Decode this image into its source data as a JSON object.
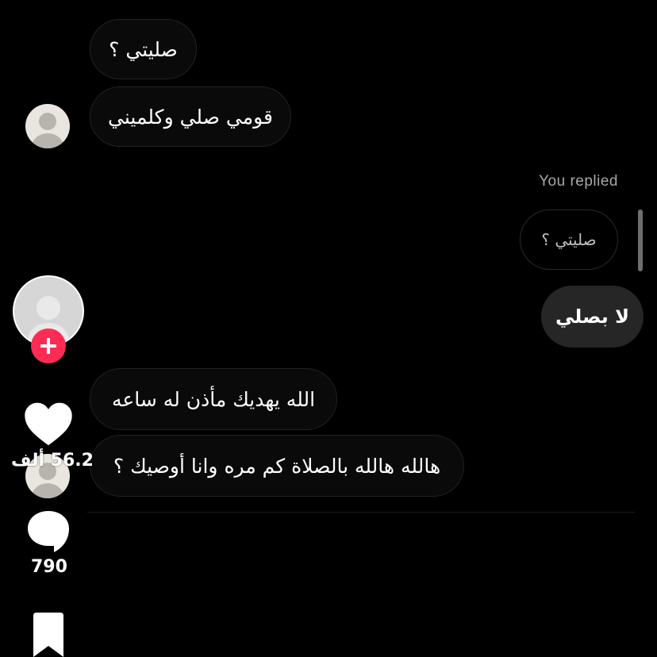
{
  "messages": [
    {
      "id": "m1",
      "text": "صليتي ؟"
    },
    {
      "id": "m2",
      "text": "قومي صلي وكلميني"
    },
    {
      "id": "m4",
      "text": "الله يهديك مأذن له ساعه"
    },
    {
      "id": "m5",
      "text": "هالله هالله بالصلاة كم مره وانا أوصيك ؟"
    }
  ],
  "reply": {
    "label": "You replied",
    "quoted_text": "صليتي ؟",
    "text": "لا بصلي"
  },
  "side_actions": {
    "likes_count": "56.2 ألف",
    "comments_count": "790"
  },
  "icons": {
    "profile_avatar": "avatar-icon",
    "follow": "plus-icon",
    "like": "heart-icon",
    "comment": "comment-bubble-icon",
    "save": "bookmark-icon"
  },
  "colors": {
    "background": "#000000",
    "bubble_incoming": "#0a0a0a",
    "bubble_outgoing": "#262626",
    "follow_badge": "#fe2c55"
  }
}
